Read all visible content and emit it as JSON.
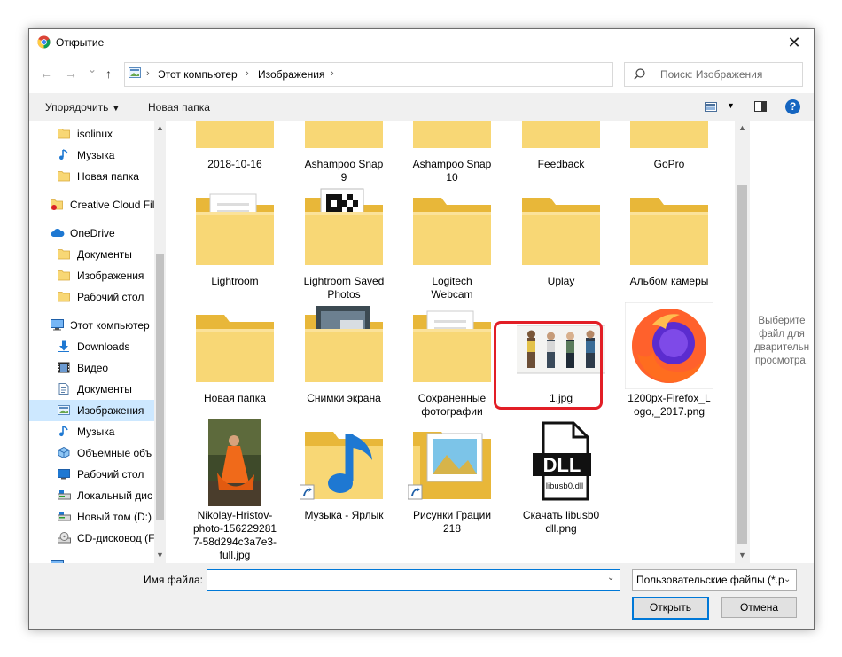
{
  "window": {
    "title": "Открытие",
    "close_glyph": "✕"
  },
  "nav": {
    "back_glyph": "←",
    "forward_glyph": "→",
    "recent_glyph": "⌄",
    "up_glyph": "↑",
    "breadcrumbs": [
      "Этот компьютер",
      "Изображения"
    ],
    "refresh_glyph": "↻",
    "search_placeholder": "Поиск: Изображения"
  },
  "toolbar": {
    "organize_label": "Упорядочить",
    "new_folder_label": "Новая папка",
    "help_label": "?"
  },
  "sidebar": {
    "items": [
      {
        "label": "isolinux",
        "icon": "folder-icon"
      },
      {
        "label": "Музыка",
        "icon": "music-icon"
      },
      {
        "label": "Новая папка",
        "icon": "folder-icon"
      },
      {
        "label": "Creative Cloud Fil",
        "icon": "creative-cloud-icon"
      },
      {
        "label": "OneDrive",
        "icon": "cloud-icon"
      },
      {
        "label": "Документы",
        "icon": "folder-icon"
      },
      {
        "label": "Изображения",
        "icon": "folder-icon"
      },
      {
        "label": "Рабочий стол",
        "icon": "folder-icon"
      },
      {
        "label": "Этот компьютер",
        "icon": "computer-icon"
      },
      {
        "label": "Downloads",
        "icon": "download-icon"
      },
      {
        "label": "Видео",
        "icon": "video-icon"
      },
      {
        "label": "Документы",
        "icon": "document-icon"
      },
      {
        "label": "Изображения",
        "icon": "pictures-icon"
      },
      {
        "label": "Музыка",
        "icon": "music-icon"
      },
      {
        "label": "Объемные объ",
        "icon": "3d-objects-icon"
      },
      {
        "label": "Рабочий стол",
        "icon": "desktop-icon"
      },
      {
        "label": "Локальный дис",
        "icon": "drive-icon"
      },
      {
        "label": "Новый том (D:)",
        "icon": "drive-icon"
      },
      {
        "label": "CD-дисковод (F",
        "icon": "cd-drive-icon"
      }
    ],
    "selected_index": 12
  },
  "files": [
    {
      "label": "2018-10-16",
      "kind": "folder"
    },
    {
      "label": "Ashampoo Snap 9",
      "kind": "folder-dark"
    },
    {
      "label": "Ashampoo Snap 10",
      "kind": "folder-photo"
    },
    {
      "label": "Feedback",
      "kind": "folder-doc"
    },
    {
      "label": "GoPro",
      "kind": "folder"
    },
    {
      "label": "Lightroom",
      "kind": "folder-doc"
    },
    {
      "label": "Lightroom Saved Photos",
      "kind": "folder-qr"
    },
    {
      "label": "Logitech Webcam",
      "kind": "folder"
    },
    {
      "label": "Uplay",
      "kind": "folder"
    },
    {
      "label": "Альбом камеры",
      "kind": "folder"
    },
    {
      "label": "Новая папка",
      "kind": "folder"
    },
    {
      "label": "Снимки экрана",
      "kind": "folder-screens"
    },
    {
      "label": "Сохраненные фотографии",
      "kind": "folder-doc"
    },
    {
      "label": "1.jpg",
      "kind": "image-people"
    },
    {
      "label": "1200px-Firefox_Logo,_2017.png",
      "kind": "image-firefox"
    },
    {
      "label": "Nikolay-Hristov-photo-1562292817-58d294c3a7e3-full.jpg",
      "kind": "image-portrait"
    },
    {
      "label": "Музыка - Ярлык",
      "kind": "shortcut-music"
    },
    {
      "label": "Рисунки Грации 218",
      "kind": "shortcut-pictures"
    },
    {
      "label": "Скачать libusb0 dll.png",
      "kind": "image-dll"
    }
  ],
  "file_labels_display": [
    [
      "2018-10-16"
    ],
    [
      "Ashampoo Snap",
      "9"
    ],
    [
      "Ashampoo Snap",
      "10"
    ],
    [
      "Feedback"
    ],
    [
      "GoPro"
    ],
    [
      "Lightroom"
    ],
    [
      "Lightroom Saved",
      "Photos"
    ],
    [
      "Logitech",
      "Webcam"
    ],
    [
      "Uplay"
    ],
    [
      "Альбом камеры"
    ],
    [
      "Новая папка"
    ],
    [
      "Снимки экрана"
    ],
    [
      "Сохраненные",
      "фотографии"
    ],
    [
      "1.jpg"
    ],
    [
      "1200px-Firefox_L",
      "ogo,_2017.png"
    ],
    [
      "Nikolay-Hristov-",
      "photo-156229281",
      "7-58d294c3a7e3-",
      "full.jpg"
    ],
    [
      "Музыка - Ярлык"
    ],
    [
      "Рисунки Грации",
      "218"
    ],
    [
      "Скачать libusb0",
      "dll.png"
    ]
  ],
  "dll_text": "DLL",
  "dll_subtext": "libusb0.dll",
  "preview": {
    "lines": [
      "Выберите",
      "файл для",
      "дварительн",
      "просмотра."
    ]
  },
  "bottom": {
    "filename_label": "Имя файла:",
    "filename_value": "",
    "filetype_value": "Пользовательские файлы (*.p",
    "open_label": "Открыть",
    "cancel_label": "Отмена"
  },
  "colors": {
    "accent": "#0078d7",
    "highlight": "#e21e26",
    "folder": "#f8d775",
    "folder_dark": "#e8b739"
  }
}
